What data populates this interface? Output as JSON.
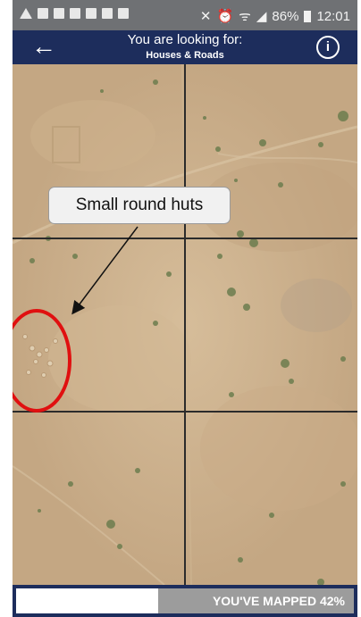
{
  "status_bar": {
    "battery": "86%",
    "time": "12:01"
  },
  "header": {
    "title": "You are looking for:",
    "subtitle": "Houses & Roads",
    "back_icon": "arrow-left-icon",
    "info_icon": "info-icon"
  },
  "annotation": {
    "callout_text": "Small round huts"
  },
  "progress": {
    "label": "YOU'VE MAPPED 42%",
    "fraction": 0.42
  },
  "colors": {
    "header_bg": "#1d2d5c",
    "status_bg": "#6f7174",
    "ground": "#c7ab88",
    "annotation_circle": "#e01010"
  }
}
